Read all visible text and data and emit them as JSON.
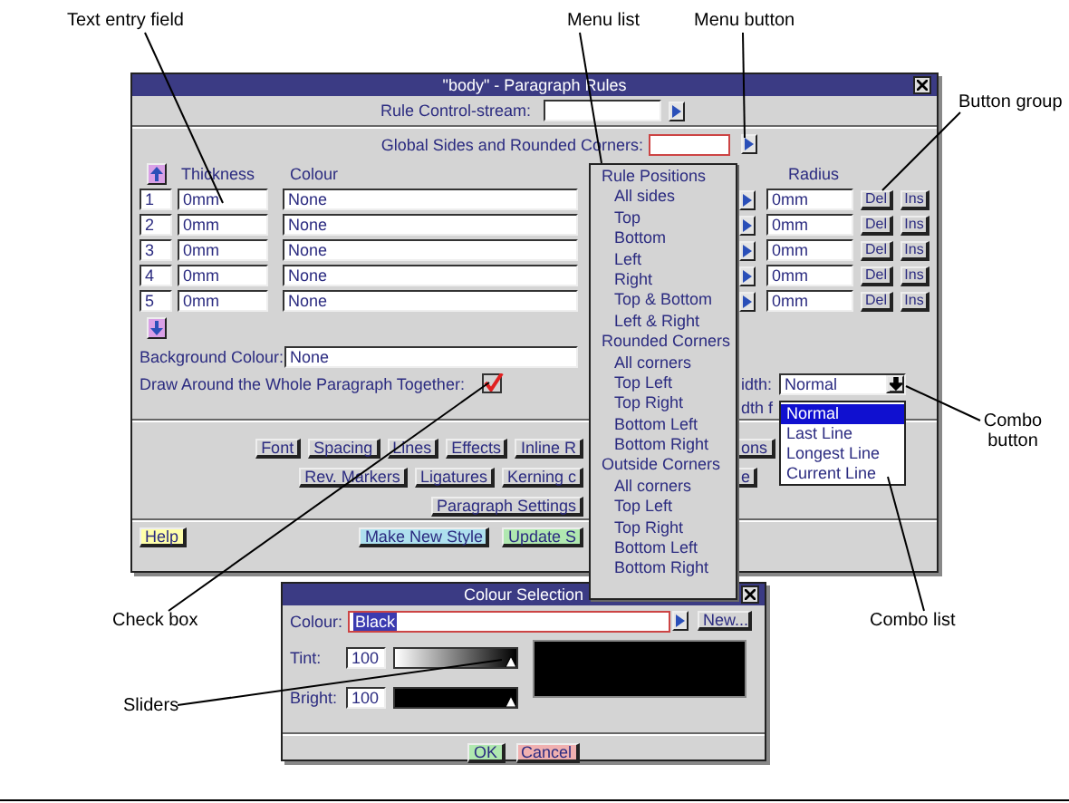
{
  "main_dialog": {
    "title": "\"body\" - Paragraph Rules",
    "control_stream": {
      "label": "Rule Control-stream:"
    },
    "global_corners": {
      "label": "Global Sides and Rounded Corners:"
    },
    "headers": {
      "thickness": "Thickness",
      "colour": "Colour",
      "radius": "Radius"
    },
    "rules": [
      {
        "number": "1",
        "thickness": "0mm",
        "colour": "None",
        "radius": "0mm",
        "delete": "Del",
        "insert": "Ins"
      },
      {
        "number": "2",
        "thickness": "0mm",
        "colour": "None",
        "radius": "0mm",
        "delete": "Del",
        "insert": "Ins"
      },
      {
        "number": "3",
        "thickness": "0mm",
        "colour": "None",
        "radius": "0mm",
        "delete": "Del",
        "insert": "Ins"
      },
      {
        "number": "4",
        "thickness": "0mm",
        "colour": "None",
        "radius": "0mm",
        "delete": "Del",
        "insert": "Ins"
      },
      {
        "number": "5",
        "thickness": "0mm",
        "colour": "None",
        "radius": "0mm",
        "delete": "Del",
        "insert": "Ins"
      }
    ],
    "background": {
      "label": "Background Colour:",
      "value": "None"
    },
    "draw_together": {
      "label": "Draw Around the Whole Paragraph Together:",
      "checked": true
    },
    "width_label": "idth:",
    "width_label_2": "dth f",
    "combo": {
      "value": "Normal",
      "options": [
        {
          "label": "Normal",
          "selected": true
        },
        {
          "label": "Last Line",
          "selected": false
        },
        {
          "label": "Longest Line",
          "selected": false
        },
        {
          "label": "Current Line",
          "selected": false
        }
      ]
    },
    "button_rows": [
      {
        "buttons": [
          "Font",
          "Spacing",
          "Lines",
          "Effects",
          "Inline R"
        ],
        "right": "ons"
      },
      {
        "buttons": [
          "Rev. Markers",
          "Ligatures",
          "Kerning c"
        ],
        "right": "e"
      },
      {
        "buttons": [
          "Paragraph Settings"
        ]
      }
    ],
    "footer": [
      {
        "label": "Help",
        "kind": "help"
      },
      {
        "label": "Make New Style",
        "kind": "new"
      },
      {
        "label": "Update S",
        "kind": "update"
      }
    ]
  },
  "menu_list": [
    {
      "label": "Rule Positions",
      "kind": "header"
    },
    {
      "label": "All sides",
      "kind": "item"
    },
    {
      "label": "Top",
      "kind": "item"
    },
    {
      "label": "Bottom",
      "kind": "item"
    },
    {
      "label": "Left",
      "kind": "item"
    },
    {
      "label": "Right",
      "kind": "item"
    },
    {
      "label": "Top & Bottom",
      "kind": "item"
    },
    {
      "label": "Left & Right",
      "kind": "item"
    },
    {
      "label": "Rounded Corners",
      "kind": "header"
    },
    {
      "label": "All corners",
      "kind": "item"
    },
    {
      "label": "Top Left",
      "kind": "item"
    },
    {
      "label": "Top Right",
      "kind": "item"
    },
    {
      "label": "Bottom Left",
      "kind": "item"
    },
    {
      "label": "Bottom Right",
      "kind": "item"
    },
    {
      "label": "Outside Corners",
      "kind": "header"
    },
    {
      "label": "All corners",
      "kind": "item"
    },
    {
      "label": "Top Left",
      "kind": "item"
    },
    {
      "label": "Top Right",
      "kind": "item"
    },
    {
      "label": "Bottom Left",
      "kind": "item"
    },
    {
      "label": "Bottom Right",
      "kind": "item"
    }
  ],
  "colour_dialog": {
    "title": "Colour Selection",
    "colour": {
      "label": "Colour:",
      "value": "Black"
    },
    "new": "New...",
    "tint": {
      "label": "Tint:",
      "value": "100",
      "level": 1
    },
    "bright": {
      "label": "Bright:",
      "value": "100",
      "level": 1
    },
    "ok": "OK",
    "cancel": "Cancel"
  },
  "callouts": [
    {
      "label": "Text entry field"
    },
    {
      "label": "Menu list"
    },
    {
      "label": "Menu button"
    },
    {
      "label": "Button group"
    },
    {
      "label": "Combo button"
    },
    {
      "label": "Combo list"
    },
    {
      "label": "Check box"
    },
    {
      "label": "Sliders"
    }
  ]
}
